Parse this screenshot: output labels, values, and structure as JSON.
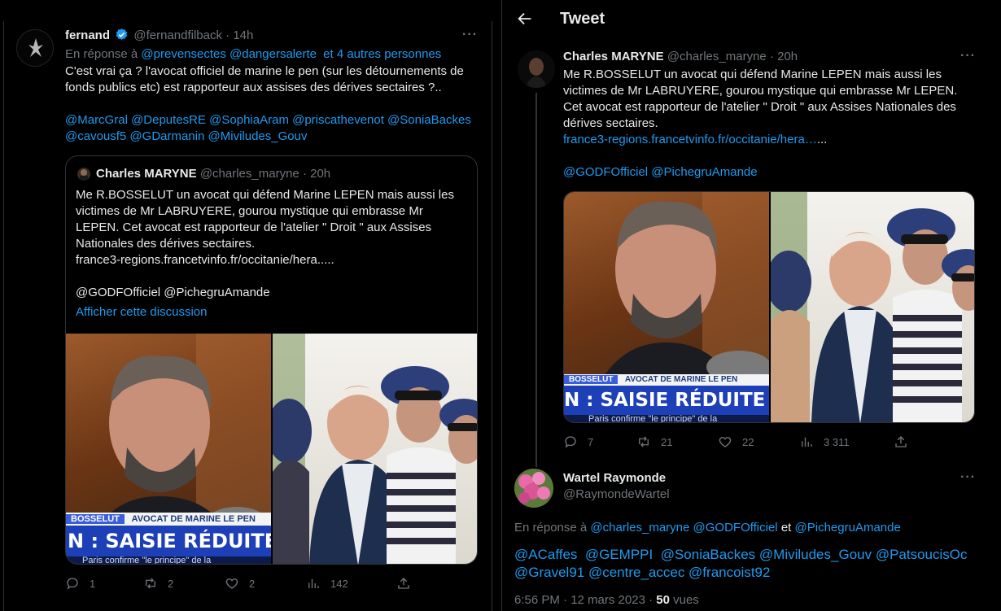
{
  "left_tweet": {
    "author_name": "fernand",
    "handle": "@fernandfilback",
    "sep": "·",
    "time": "14h",
    "reply_prefix": "En réponse à",
    "reply_mentions": "@prevensectes @dangersalerte",
    "reply_others": "et 4 autres personnes",
    "text_lines": [
      "C'est vrai ça ? l'avocat officiel de marine le pen (sur les détournements de",
      "fonds publics etc) est rapporteur aux assises des dérives sectaires ?.."
    ],
    "mention_lines": [
      "@MarcGral @DeputesRE @SophiaAram @priscathevenot @SoniaBackes",
      "@cavousf5 @GDarmanin @Miviludes_Gouv"
    ],
    "quoted": {
      "author_name": "Charles MARYNE",
      "handle": "@charles_maryne",
      "sep": "·",
      "time": "20h",
      "text_lines": [
        "Me R.BOSSELUT un avocat qui défend Marine LEPEN mais aussi les",
        "victimes de Mr LABRUYERE, gourou mystique qui embrasse Mr",
        "LEPEN. Cet avocat est rapporteur de l'atelier \" Droit \" aux Assises",
        "Nationales des dérives sectaires.",
        "france3-regions.francetvinfo.fr/occitanie/hera....."
      ],
      "mentions": "@GODFOfficiel @PichegruAmande",
      "show_thread": "Afficher cette discussion"
    },
    "actions": {
      "replies": "1",
      "retweets": "2",
      "likes": "2",
      "views": "142"
    }
  },
  "header": {
    "back_icon": "arrow-left-icon",
    "title": "Tweet"
  },
  "main_tweet": {
    "author_name": "Charles MARYNE",
    "handle": "@charles_maryne",
    "sep": "·",
    "time": "20h",
    "text_lines": [
      "Me R.BOSSELUT un avocat qui défend Marine LEPEN mais aussi les",
      "victimes de Mr LABRUYERE, gourou mystique qui embrasse Mr LEPEN.",
      "Cet avocat est rapporteur de l'atelier \" Droit \" aux Assises Nationales des",
      "dérives sectaires."
    ],
    "link": "france3-regions.francetvinfo.fr/occitanie/hera…",
    "link_suffix": "...",
    "mentions": "@GODFOfficiel @PichegruAmande",
    "actions": {
      "replies": "7",
      "retweets": "21",
      "likes": "22",
      "views": "3 311"
    }
  },
  "images": {
    "banner_name": "BOSSELUT",
    "banner_title": "AVOCAT DE MARINE LE PEN",
    "headline": "N : SAISIE RÉDUITE POUI",
    "ticker": "Paris confirme \"le principe\" de la"
  },
  "reply_tweet": {
    "author_name": "Wartel Raymonde",
    "handle": "@RaymondeWartel",
    "reply_prefix": "En réponse à",
    "reply_mentions": "@charles_maryne @GODFOfficiel",
    "reply_and": "et",
    "reply_last": "@PichegruAmande",
    "mention_lines": [
      "@ACaffes  @GEMPPI  @SoniaBackes @Miviludes_Gouv @PatsoucisOc",
      "@Gravel91 @centre_accec @francoist92"
    ],
    "time": "6:56 PM · 12 mars 2023 ·",
    "views_count": "50",
    "views_label": "vues"
  },
  "colors": {
    "accent": "#1d9bf0",
    "muted": "#71767b",
    "text": "#e7e9ea",
    "border": "#2f3336",
    "verified": "#1d9bf0"
  }
}
